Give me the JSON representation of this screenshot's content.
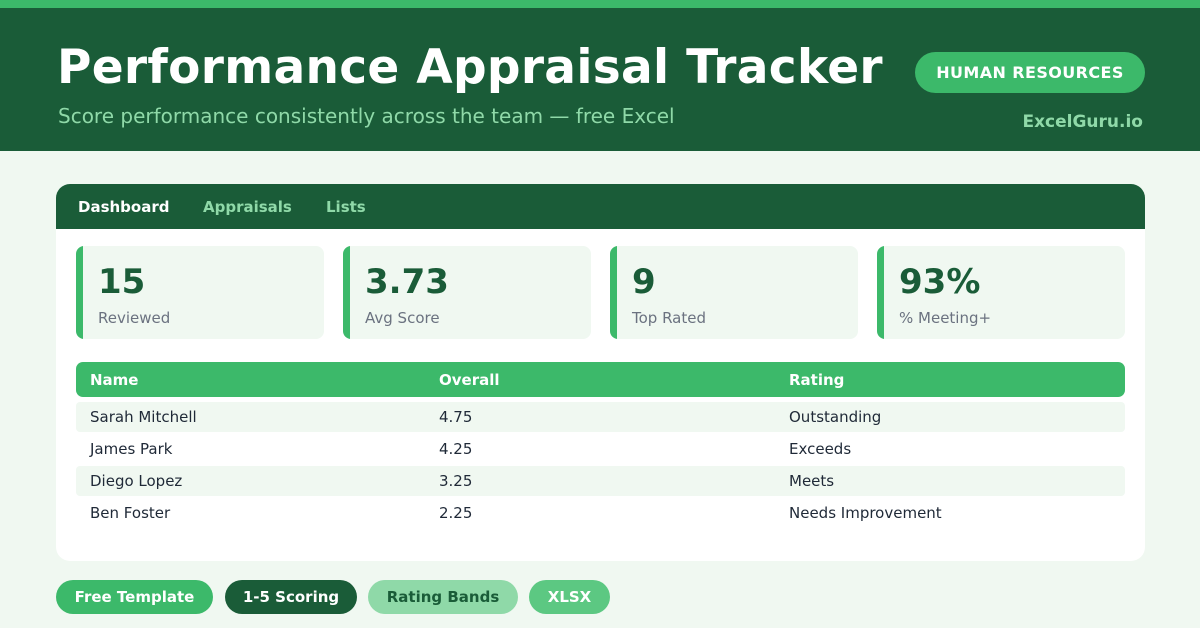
{
  "header": {
    "title": "Performance Appraisal Tracker",
    "subtitle": "Score performance consistently across the team — free Excel",
    "badge": "HUMAN RESOURCES",
    "brand": "ExcelGuru.io"
  },
  "tabs": [
    {
      "label": "Dashboard",
      "active": true
    },
    {
      "label": "Appraisals",
      "active": false
    },
    {
      "label": "Lists",
      "active": false
    }
  ],
  "kpis": [
    {
      "value": "15",
      "label": "Reviewed"
    },
    {
      "value": "3.73",
      "label": "Avg Score"
    },
    {
      "value": "9",
      "label": "Top Rated"
    },
    {
      "value": "93%",
      "label": "% Meeting+"
    }
  ],
  "table": {
    "columns": [
      "Name",
      "Overall",
      "Rating"
    ],
    "rows": [
      [
        "Sarah Mitchell",
        "4.75",
        "Outstanding"
      ],
      [
        "James Park",
        "4.25",
        "Exceeds"
      ],
      [
        "Diego Lopez",
        "3.25",
        "Meets"
      ],
      [
        "Ben Foster",
        "2.25",
        "Needs Improvement"
      ]
    ]
  },
  "tags": [
    "Free Template",
    "1-5 Scoring",
    "Rating Bands",
    "XLSX"
  ],
  "colors": {
    "dark_green": "#1a5c38",
    "accent_green": "#3cb96a",
    "light_green": "#8fd9a8",
    "background": "#f0f8f1"
  }
}
